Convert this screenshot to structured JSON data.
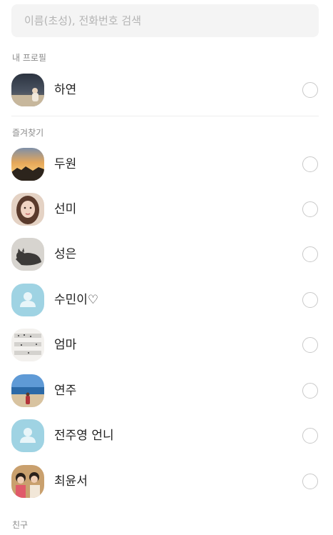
{
  "search": {
    "placeholder": "이름(초성), 전화번호 검색"
  },
  "sections": {
    "my_profile": "내 프로필",
    "favorites": "즐겨찾기",
    "friends": "친구"
  },
  "my_profile": {
    "name": "하연",
    "selected": false
  },
  "favorites": [
    {
      "name": "두원",
      "avatar": "sunset-photo",
      "selected": false
    },
    {
      "name": "선미",
      "avatar": "portrait-photo",
      "selected": false
    },
    {
      "name": "성은",
      "avatar": "cat-photo",
      "selected": false
    },
    {
      "name": "수민이♡",
      "avatar": "default-person",
      "selected": false
    },
    {
      "name": "엄마",
      "avatar": "sheet-music-photo",
      "selected": false
    },
    {
      "name": "연주",
      "avatar": "beach-photo",
      "selected": false
    },
    {
      "name": "전주영 언니",
      "avatar": "default-person",
      "selected": false
    },
    {
      "name": "최윤서",
      "avatar": "group-photo",
      "selected": false
    }
  ],
  "colors": {
    "default_avatar": "#9fd3e3",
    "radio_border": "#c9c9c9",
    "section_label": "#8a8a8a"
  }
}
